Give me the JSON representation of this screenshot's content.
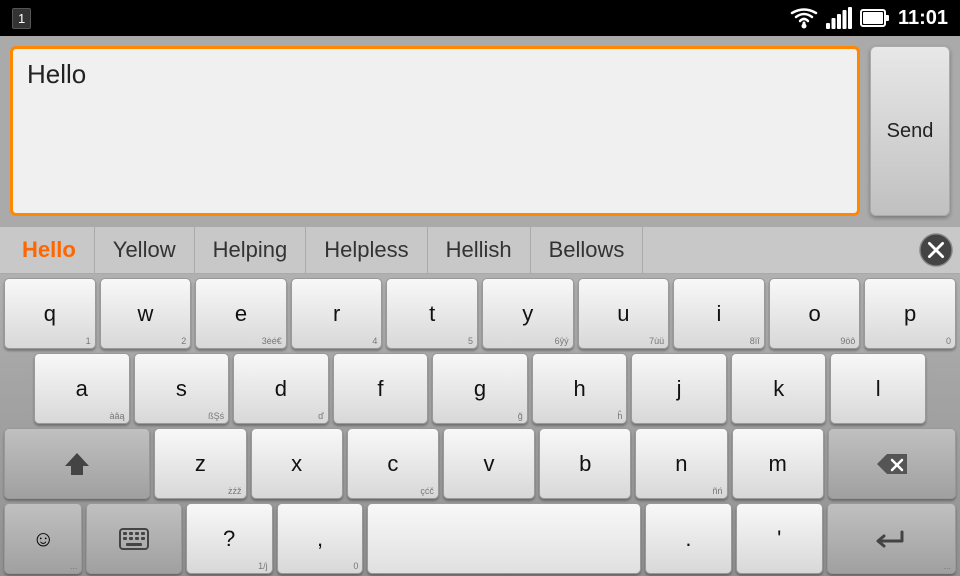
{
  "status_bar": {
    "notification_icon": "1",
    "time": "11:01"
  },
  "input_area": {
    "text_value": "Hello",
    "send_label": "Send"
  },
  "suggestions": {
    "items": [
      "Hello",
      "Yellow",
      "Helping",
      "Helpless",
      "Hellish",
      "Bellows"
    ],
    "close_label": "✕"
  },
  "keyboard": {
    "row1": [
      {
        "main": "q",
        "sub": "1"
      },
      {
        "main": "w",
        "sub": "2"
      },
      {
        "main": "e",
        "sub": "3èé€"
      },
      {
        "main": "r",
        "sub": "4"
      },
      {
        "main": "t",
        "sub": "5"
      },
      {
        "main": "y",
        "sub": "6ŷý"
      },
      {
        "main": "u",
        "sub": "7ùü"
      },
      {
        "main": "i",
        "sub": "8ïî"
      },
      {
        "main": "o",
        "sub": "9öô"
      },
      {
        "main": "p",
        "sub": "0"
      }
    ],
    "row2": [
      {
        "main": "a",
        "sub": "àâą"
      },
      {
        "main": "s",
        "sub": "ßẞś"
      },
      {
        "main": "d",
        "sub": "ď"
      },
      {
        "main": "f",
        "sub": ""
      },
      {
        "main": "g",
        "sub": "ğ"
      },
      {
        "main": "h",
        "sub": "ĥ"
      },
      {
        "main": "j",
        "sub": ""
      },
      {
        "main": "k",
        "sub": ""
      },
      {
        "main": "l",
        "sub": ""
      }
    ],
    "row3": [
      {
        "main": "↑",
        "sub": "",
        "type": "shift"
      },
      {
        "main": "z",
        "sub": "żźž"
      },
      {
        "main": "x",
        "sub": ""
      },
      {
        "main": "c",
        "sub": "çćč"
      },
      {
        "main": "v",
        "sub": ""
      },
      {
        "main": "b",
        "sub": ""
      },
      {
        "main": "n",
        "sub": "ñń"
      },
      {
        "main": "m",
        "sub": ""
      },
      {
        "main": "⌫",
        "sub": "",
        "type": "backspace"
      }
    ],
    "row4": [
      {
        "main": "☺",
        "sub": "...",
        "type": "emoji"
      },
      {
        "main": "⌨",
        "sub": "",
        "type": "keyboard"
      },
      {
        "main": "?",
        "sub": "1/j"
      },
      {
        "main": ",",
        "sub": "0"
      },
      {
        "main": " ",
        "sub": "",
        "type": "space"
      },
      {
        "main": ".",
        "sub": ""
      },
      {
        "main": "'",
        "sub": ""
      },
      {
        "main": "↵",
        "sub": "...",
        "type": "enter"
      }
    ]
  }
}
